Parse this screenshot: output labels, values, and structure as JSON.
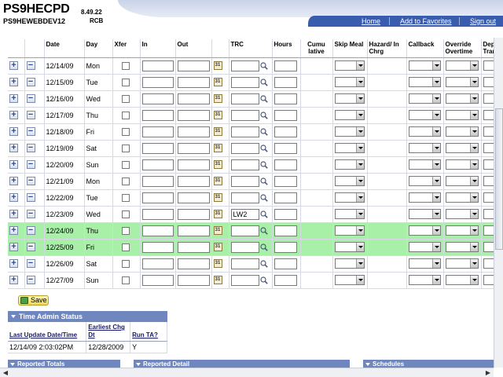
{
  "header": {
    "app_name": "PS9HECPD",
    "app_version": "8.49.22",
    "database": "PS9HEWEBDEV12",
    "user": "RCB",
    "nav": {
      "home": "Home",
      "add_favorites": "Add to Favorites",
      "sign_out": "Sign out"
    }
  },
  "grid": {
    "headers": {
      "date": "Date",
      "day": "Day",
      "xfer": "Xfer",
      "in": "In",
      "out": "Out",
      "trc": "TRC",
      "hours": "Hours",
      "cumulative": "Cumu lative",
      "skip_meal": "Skip Meal",
      "hazard": "Hazard/ In Chrg",
      "callback": "Callback",
      "override": "Override Overtime",
      "dep": "Dep Tran"
    },
    "add_symbol": "+",
    "remove_symbol": "−",
    "rows": [
      {
        "date": "12/14/09",
        "day": "Mon",
        "trc": "",
        "highlight": false
      },
      {
        "date": "12/15/09",
        "day": "Tue",
        "trc": "",
        "highlight": false
      },
      {
        "date": "12/16/09",
        "day": "Wed",
        "trc": "",
        "highlight": false
      },
      {
        "date": "12/17/09",
        "day": "Thu",
        "trc": "",
        "highlight": false
      },
      {
        "date": "12/18/09",
        "day": "Fri",
        "trc": "",
        "highlight": false
      },
      {
        "date": "12/19/09",
        "day": "Sat",
        "trc": "",
        "highlight": false
      },
      {
        "date": "12/20/09",
        "day": "Sun",
        "trc": "",
        "highlight": false
      },
      {
        "date": "12/21/09",
        "day": "Mon",
        "trc": "",
        "highlight": false
      },
      {
        "date": "12/22/09",
        "day": "Tue",
        "trc": "",
        "highlight": false
      },
      {
        "date": "12/23/09",
        "day": "Wed",
        "trc": "LW2",
        "highlight": false
      },
      {
        "date": "12/24/09",
        "day": "Thu",
        "trc": "",
        "highlight": true
      },
      {
        "date": "12/25/09",
        "day": "Fri",
        "trc": "",
        "highlight": true
      },
      {
        "date": "12/26/09",
        "day": "Sat",
        "trc": "",
        "highlight": false
      },
      {
        "date": "12/27/09",
        "day": "Sun",
        "trc": "",
        "highlight": false
      }
    ]
  },
  "save": {
    "label": "Save"
  },
  "time_admin": {
    "title": "Time Admin Status",
    "headers": {
      "last_update": "Last Update Date/Time",
      "earliest": "Earliest Chg Dt",
      "run_ta": "Run TA?"
    },
    "row": {
      "last_update": "12/14/09 2:03:02PM",
      "earliest": "12/28/2009",
      "run_ta": "Y"
    }
  },
  "panels": {
    "reported_totals": "Reported Totals",
    "reported_detail": "Reported Detail",
    "schedules": "Schedules"
  },
  "colors": {
    "highlight_row": "#a8f0a8",
    "nav_bar": "#3a5cae",
    "section_header": "#6f86bf"
  }
}
